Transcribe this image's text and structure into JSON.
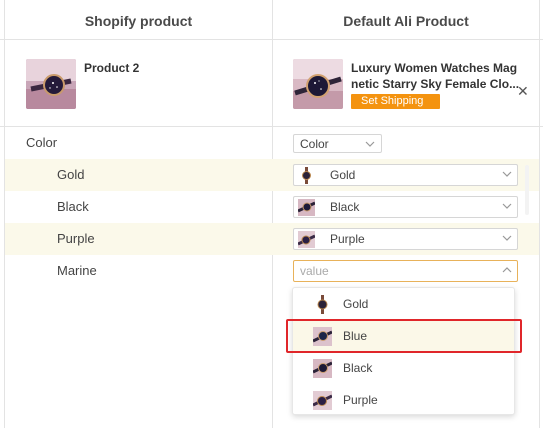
{
  "header": {
    "shopify_label": "Shopify product",
    "ali_label": "Default Ali Product"
  },
  "shopify_product": {
    "title": "Product 2",
    "thumb_icon": "watch-product-thumbnail"
  },
  "ali_product": {
    "title": "Luxury Women Watches Magnetic Starry Sky Female Clo...",
    "title_line1": "Luxury Women Watches Mag",
    "title_line2": "netic Starry Sky Female Clo...",
    "set_shipping_label": "Set Shipping",
    "close_icon": "close-icon",
    "set_shipping_color": "#f4930f"
  },
  "option": {
    "name": "Color",
    "select_value": "Color"
  },
  "variants": [
    {
      "label": "Gold",
      "mapped": "Gold"
    },
    {
      "label": "Black",
      "mapped": "Black"
    },
    {
      "label": "Purple",
      "mapped": "Purple"
    },
    {
      "label": "Marine",
      "mapped": "",
      "placeholder": "value"
    }
  ],
  "dropdown": {
    "options": [
      "Gold",
      "Blue",
      "Black",
      "Purple"
    ],
    "highlighted": "Blue",
    "highlight_color": "#e0262a"
  },
  "colors": {
    "row_alt_bg": "#fbf9ea",
    "border": "#e3e3e3"
  }
}
